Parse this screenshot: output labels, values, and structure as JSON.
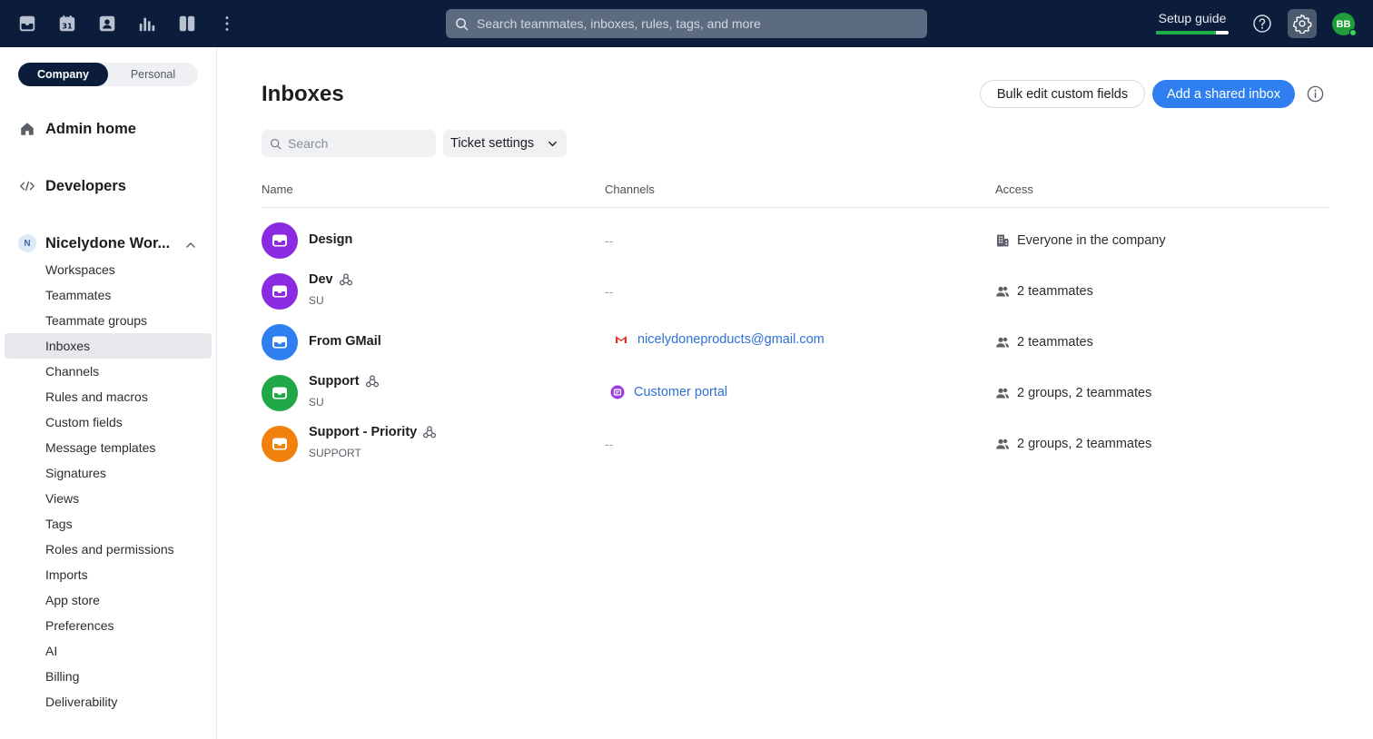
{
  "topbar": {
    "search_placeholder": "Search teammates, inboxes, rules, tags, and more",
    "setup_guide_label": "Setup guide",
    "setup_progress": 0.82,
    "avatar_initials": "BB",
    "icons": [
      "inbox-icon",
      "calendar-icon",
      "contacts-icon",
      "analytics-icon",
      "columns-icon",
      "more-vertical-icon",
      "search-icon",
      "help-icon",
      "gear-icon"
    ],
    "calendar_day": "31",
    "accent_color": "#2f7ff0",
    "bar_color": "#0b1d3a"
  },
  "sidebar": {
    "toggle": {
      "company": "Company",
      "personal": "Personal"
    },
    "admin_home": "Admin home",
    "developers": "Developers",
    "workspace": {
      "badge": "N",
      "name": "Nicelydone Wor..."
    },
    "items": [
      "Workspaces",
      "Teammates",
      "Teammate groups",
      "Inboxes",
      "Channels",
      "Rules and macros",
      "Custom fields",
      "Message templates",
      "Signatures",
      "Views",
      "Tags",
      "Roles and permissions",
      "Imports",
      "App store",
      "Preferences",
      "AI",
      "Billing",
      "Deliverability"
    ],
    "active_item": "Inboxes"
  },
  "main": {
    "title": "Inboxes",
    "bulk_edit_label": "Bulk edit custom fields",
    "add_inbox_label": "Add a shared inbox",
    "search_placeholder": "Search",
    "ticket_settings_label": "Ticket settings",
    "columns": {
      "name": "Name",
      "channels": "Channels",
      "access": "Access"
    },
    "rows": [
      {
        "name": "Design",
        "sub": "",
        "color": "#8a2be2",
        "shared": false,
        "channel": "--",
        "channel_type": "none",
        "access": "Everyone in the company",
        "access_icon": "building-icon"
      },
      {
        "name": "Dev",
        "sub": "SU",
        "color": "#8a2be2",
        "shared": true,
        "channel": "--",
        "channel_type": "none",
        "access": "2 teammates",
        "access_icon": "users-icon"
      },
      {
        "name": "From GMail",
        "sub": "",
        "color": "#2f7ff0",
        "shared": false,
        "channel": "nicelydoneproducts@gmail.com",
        "channel_type": "gmail",
        "access": "2 teammates",
        "access_icon": "users-icon"
      },
      {
        "name": "Support",
        "sub": "SU",
        "color": "#1fa845",
        "shared": true,
        "channel": "Customer portal",
        "channel_type": "portal",
        "access": "2 groups, 2 teammates",
        "access_icon": "users-icon"
      },
      {
        "name": "Support - Priority",
        "sub": "SUPPORT",
        "color": "#f2800d",
        "shared": true,
        "channel": "--",
        "channel_type": "none",
        "access": "2 groups, 2 teammates",
        "access_icon": "users-icon"
      }
    ]
  }
}
